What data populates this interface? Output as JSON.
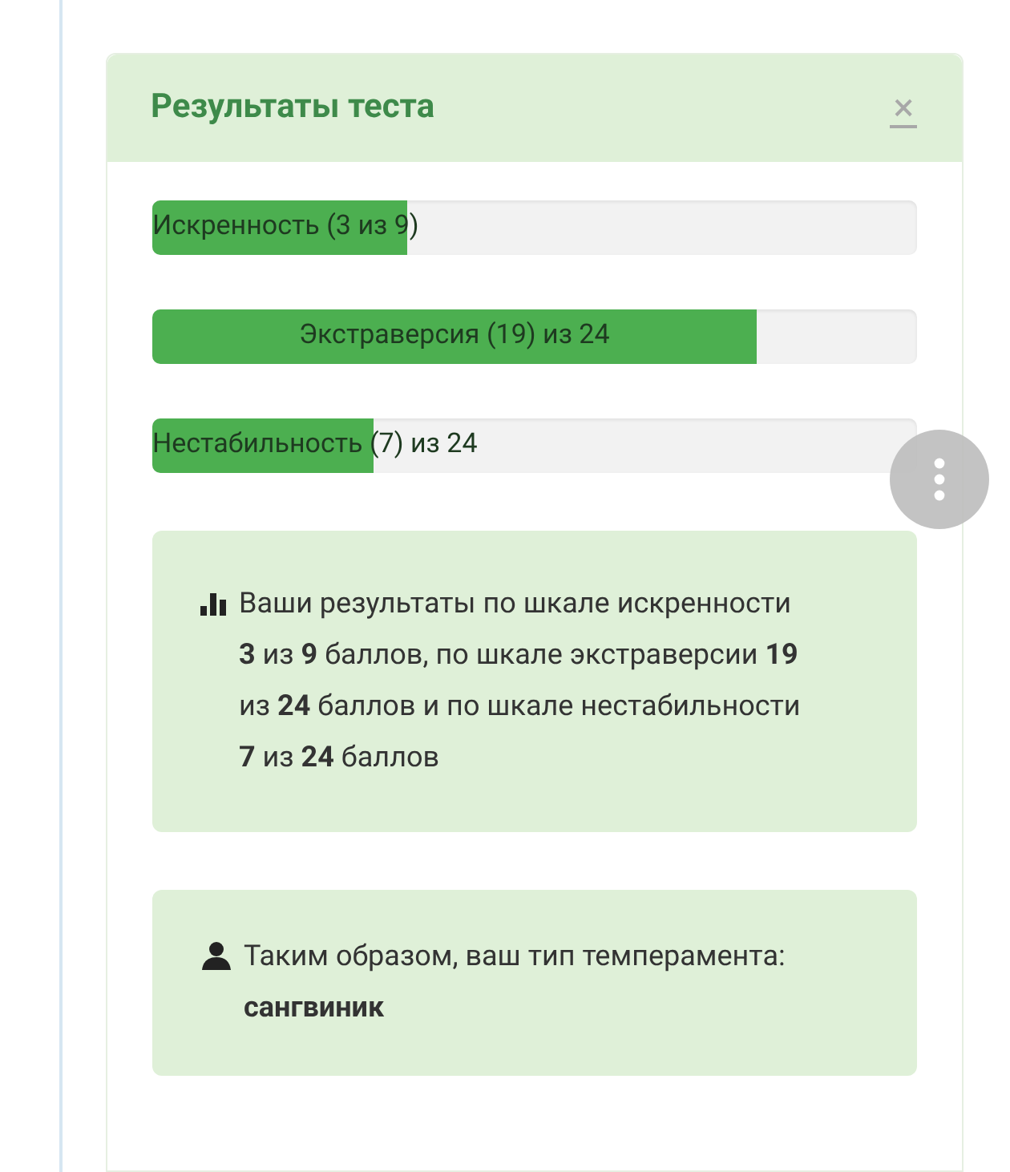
{
  "panel": {
    "title": "Результаты теста",
    "close": "×"
  },
  "scales": [
    {
      "label": "Искренность (3 из 9)",
      "level": 0.333
    },
    {
      "label": "Экстраверсия (19) из 24",
      "level": 0.79
    },
    {
      "label": "Нестабильность (7) из 24",
      "level": 0.29
    }
  ],
  "notes": [
    {
      "kind": "chart",
      "text": "Ваши результаты по шкале искренности **3** из **9** баллов, по шкале экстраверсии **19** из **24** баллов и по шкале нестабильности **7** из **24** баллов"
    },
    {
      "kind": "person",
      "text": "Таким образом, ваш тип темперамента: **сангвиник**"
    }
  ]
}
